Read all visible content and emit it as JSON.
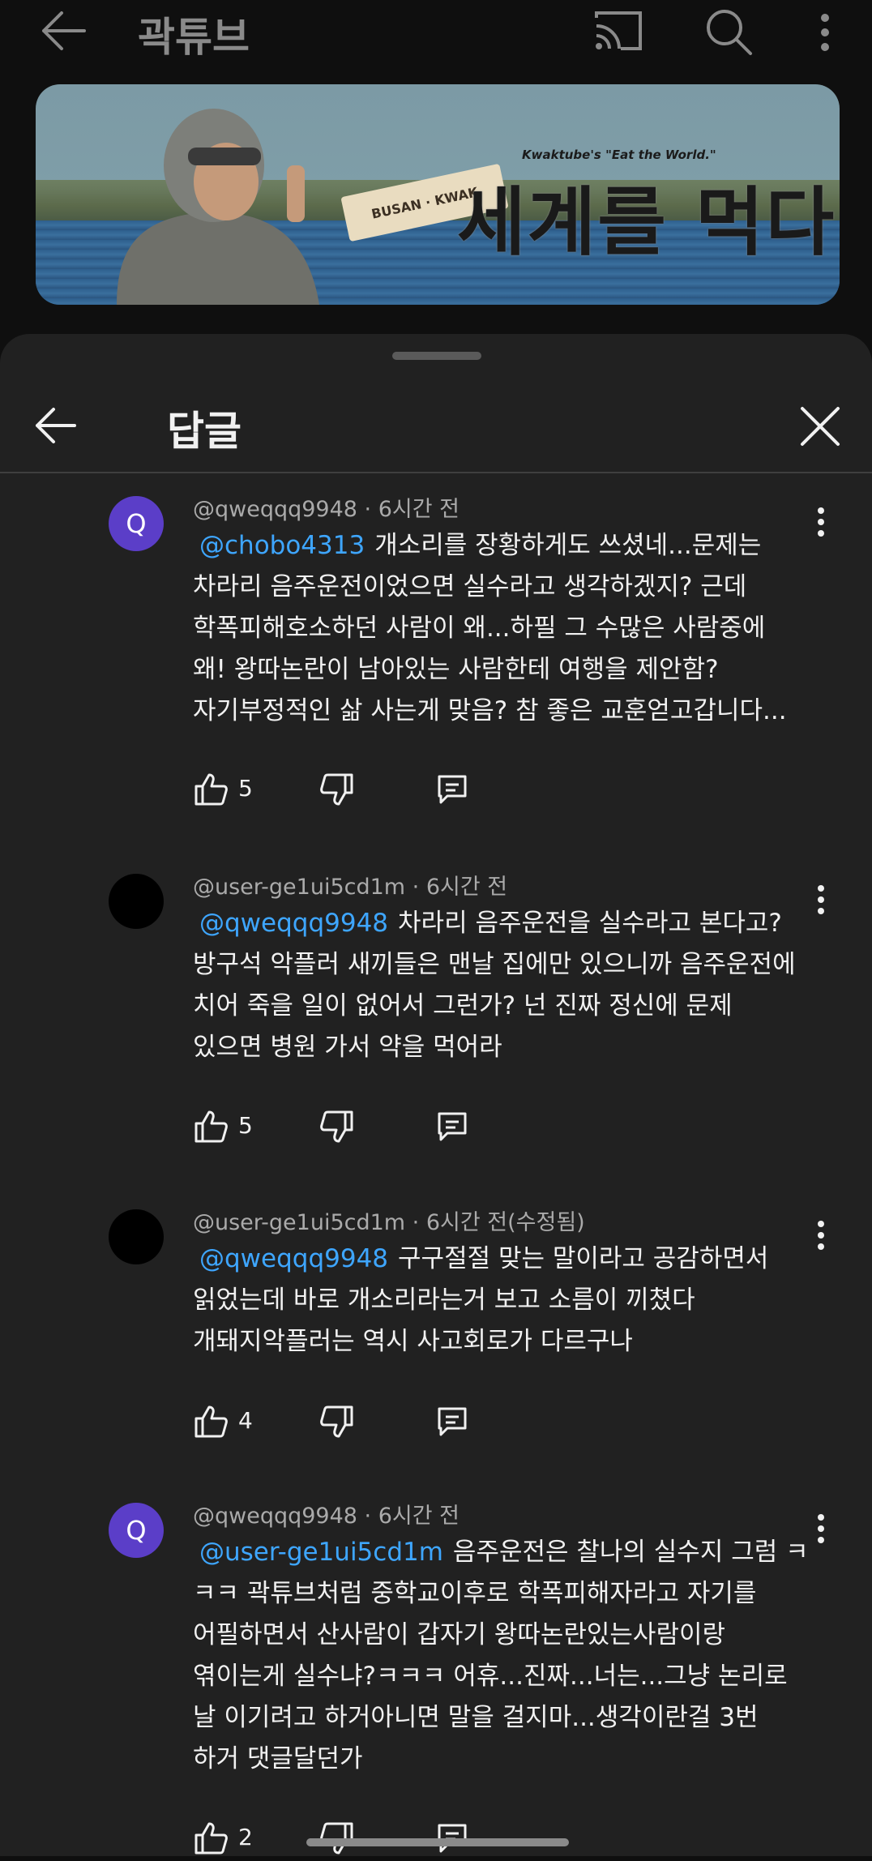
{
  "header": {
    "channel_title": "곽튜브",
    "back_icon": "arrow-left-icon",
    "cast_icon": "cast-icon",
    "search_icon": "search-icon",
    "more_icon": "more-vert-icon"
  },
  "banner": {
    "tagline": "Kwaktube's \"Eat the World.\"",
    "sign_text": "BUSAN · KWAK",
    "headline": "세계를 먹다"
  },
  "sheet": {
    "title": "답글",
    "back_icon": "arrow-left-icon",
    "close_icon": "close-icon"
  },
  "colors": {
    "background": "#0f0f0f",
    "sheet": "#212121",
    "mention": "#3ea6ff",
    "avatar_purple": "#5b3ec8",
    "avatar_black": "#000000"
  },
  "comments": [
    {
      "avatar_letter": "Q",
      "author": "@qweqqq9948",
      "time": "6시간 전",
      "mention": "@chobo4313",
      "lines": [
        "개소리를 장황하게도 쓰셨네...문제는",
        "차라리 음주운전이었으면 실수라고 생각하겠지? 근데",
        "학폭피해호소하던 사람이 왜...하필 그 수많은 사람중에",
        "왜! 왕따논란이 남아있는 사람한테  여행을 제안함?",
        "자기부정적인 삶 사는게 맞음? 참 좋은 교훈얻고갑니다..."
      ],
      "likes": "5"
    },
    {
      "avatar_letter": "",
      "author": "@user-ge1ui5cd1m",
      "time": "6시간 전",
      "mention": "@qweqqq9948",
      "lines": [
        "차라리 음주운전을 실수라고 본다고?",
        "방구석 악플러 새끼들은 맨날 집에만 있으니까 음주운전에",
        "치어 죽을 일이 없어서 그런가? 넌 진짜 정신에 문제",
        "있으면 병원 가서 약을 먹어라"
      ],
      "likes": "5"
    },
    {
      "avatar_letter": "",
      "author": "@user-ge1ui5cd1m",
      "time": "6시간 전(수정됨)",
      "mention": "@qweqqq9948",
      "lines": [
        "구구절절 맞는 말이라고 공감하면서",
        "읽었는데 바로 개소리라는거 보고 소름이 끼쳤다",
        "개돼지악플러는 역시 사고회로가 다르구나"
      ],
      "likes": "4"
    },
    {
      "avatar_letter": "Q",
      "author": "@qweqqq9948",
      "time": "6시간 전",
      "mention": "@user-ge1ui5cd1m",
      "lines": [
        "음주운전은 찰나의 실수지 그럼 ㅋ",
        "ㅋㅋ 곽튜브처럼 중학교이후로 학폭피해자라고 자기를",
        "어필하면서 산사람이 갑자기 왕따논란있는사람이랑",
        "엮이는게 실수냐?ㅋㅋㅋ 어휴...진짜...너는...그냥 논리로",
        "날 이기려고 하거아니면 말을 걸지마...생각이란걸 3번",
        "하거 댓글달던가"
      ],
      "likes": "2"
    }
  ]
}
